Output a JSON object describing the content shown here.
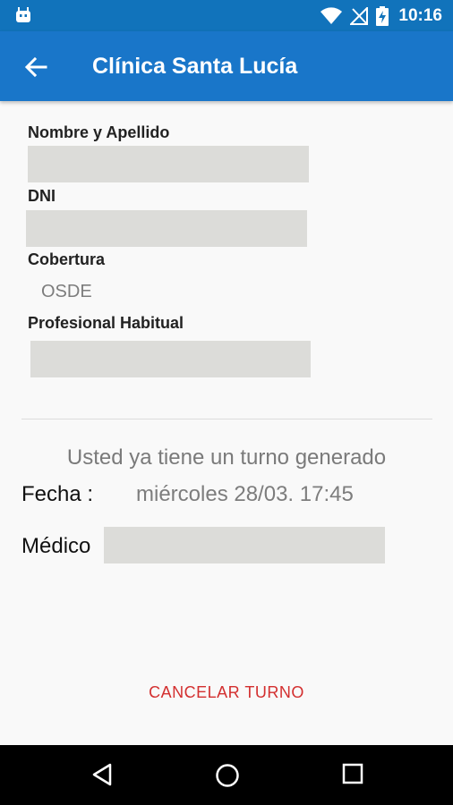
{
  "status_bar": {
    "time": "10:16",
    "icons": [
      "android-notification-icon",
      "wifi-icon",
      "no-signal-icon",
      "battery-charging-icon"
    ]
  },
  "app_bar": {
    "title": "Clínica Santa Lucía",
    "back_icon": "arrow-back-icon"
  },
  "form": {
    "nombre_label": "Nombre y Apellido",
    "dni_label": "DNI",
    "cobertura_label": "Cobertura",
    "cobertura_value": "OSDE",
    "profesional_label": "Profesional Habitual"
  },
  "turno": {
    "notice": "Usted ya tiene un turno generado",
    "fecha_label": "Fecha :",
    "fecha_value": "miércoles 28/03. 17:45",
    "medico_label": "Médico"
  },
  "cancel_button": "CANCELAR TURNO",
  "nav_bar": {
    "icons": [
      "back-triangle-icon",
      "home-circle-icon",
      "recents-square-icon"
    ]
  },
  "colors": {
    "status_bar": "#1173bb",
    "app_bar": "#1976c9",
    "cancel": "#d32f2f",
    "redacted_field": "#dcdcd9"
  }
}
